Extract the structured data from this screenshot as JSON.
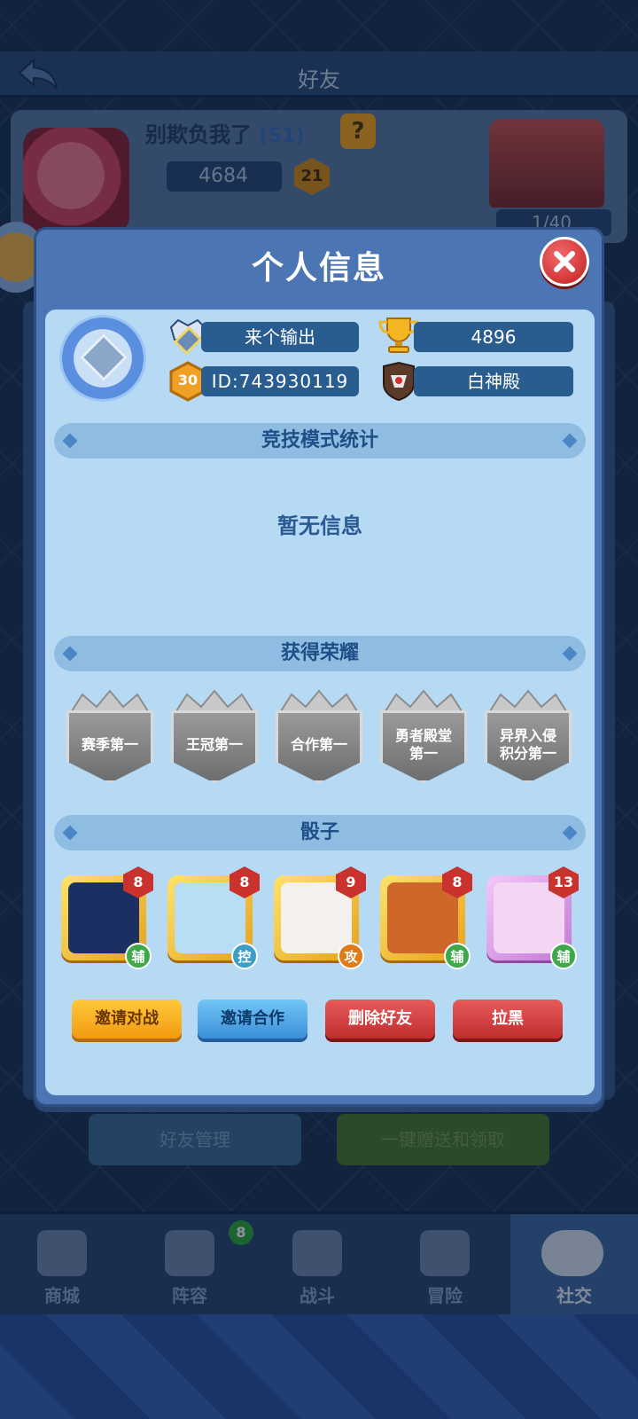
{
  "page": {
    "title": "好友",
    "friend": {
      "name": "别欺负我了",
      "season": "(S1)",
      "help_badge": "?",
      "trophies": "4684",
      "level": "21",
      "hearts": "1/40"
    },
    "manage_button": "好友管理",
    "gift_button": "一键赠送和领取"
  },
  "dialog": {
    "title": "个人信息",
    "player": {
      "name": "来个输出",
      "trophies": "4896",
      "level": "30",
      "id": "ID:743930119",
      "guild": "白神殿"
    },
    "sections": {
      "arena_stats": "竞技模式统计",
      "arena_empty": "暂无信息",
      "honors": "获得荣耀",
      "dice": "骰子"
    },
    "honors": [
      {
        "label": "赛季第一"
      },
      {
        "label": "王冠第一"
      },
      {
        "label": "合作第一"
      },
      {
        "label": "勇者殿堂\n第一"
      },
      {
        "label": "异界入侵\n积分第一"
      }
    ],
    "dice": [
      {
        "level": "8",
        "type": "辅",
        "icon": "lightning-dandelion-dice",
        "color": "#1c2f63"
      },
      {
        "level": "8",
        "type": "控",
        "icon": "ice-wings-dice",
        "color": "#b8def6"
      },
      {
        "level": "9",
        "type": "攻",
        "icon": "shuriken-dice",
        "color": "#f3f0ee"
      },
      {
        "level": "8",
        "type": "辅",
        "icon": "dual-figure-dice",
        "color": "#d0672a"
      },
      {
        "level": "13",
        "type": "辅",
        "icon": "puzzle-dice",
        "color": "#f3d6f3"
      }
    ],
    "actions": {
      "invite_battle": "邀请对战",
      "invite_coop": "邀请合作",
      "delete_friend": "删除好友",
      "block": "拉黑"
    }
  },
  "nav": {
    "items": [
      {
        "label": "商城",
        "icon": "shop-icon"
      },
      {
        "label": "阵容",
        "icon": "dice-icon",
        "badge": "8"
      },
      {
        "label": "战斗",
        "icon": "swords-icon"
      },
      {
        "label": "冒险",
        "icon": "adventure-icon"
      },
      {
        "label": "社交",
        "icon": "chat-icon",
        "active": true
      }
    ]
  }
}
